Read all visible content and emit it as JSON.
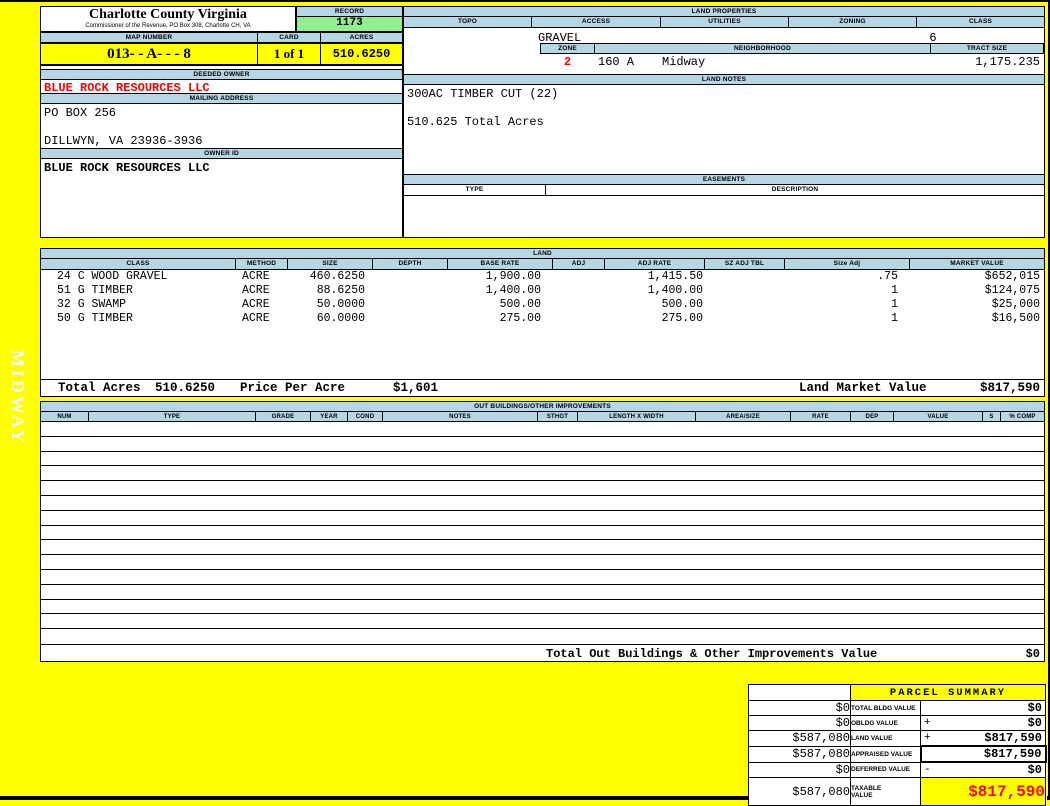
{
  "colors": {
    "header_bar": "#b5d7e5",
    "highlight_yellow": "#ffff00",
    "record_green": "#90ee90",
    "alert_red": "#ff0000"
  },
  "sidebar": {
    "district_label": "MIDWAY"
  },
  "header": {
    "county_title": "Charlotte County Virginia",
    "county_subtitle": "Commissioner of the Revenue, PO Box 308, Charlotte CH, VA",
    "record_label": "RECORD",
    "record_value": "1173",
    "map_number_label": "MAP NUMBER",
    "map_number_value": "013- - A- - - 8",
    "card_label": "CARD",
    "card_value": "1 of 1",
    "acres_label": "ACRES",
    "acres_value": "510.6250"
  },
  "owner": {
    "deeded_owner_label": "DEEDED OWNER",
    "deeded_owner_name": "BLUE ROCK RESOURCES LLC",
    "mailing_address_label": "MAILING ADDRESS",
    "mailing_address_line1": "PO BOX 256",
    "mailing_address_line2": "DILLWYN, VA 23936-3936",
    "owner_id_label": "OWNER ID",
    "owner_id_value": "BLUE ROCK RESOURCES LLC"
  },
  "land_properties": {
    "title": "LAND PROPERTIES",
    "columns": [
      "TOPO",
      "ACCESS",
      "UTILITIES",
      "ZONING",
      "CLASS"
    ],
    "access_value": "GRAVEL",
    "class_value": "6",
    "zone_label": "ZONE",
    "zone_value": "2",
    "neighborhood_label": "NEIGHBORHOOD",
    "neighborhood_code": "160 A",
    "neighborhood_name": "Midway",
    "tract_size_label": "TRACT SIZE",
    "tract_size_value": "1,175.235"
  },
  "land_notes": {
    "title": "LAND NOTES",
    "lines": [
      "300AC TIMBER CUT (22)",
      "510.625 Total Acres"
    ]
  },
  "easements": {
    "title": "EASEMENTS",
    "type_label": "TYPE",
    "description_label": "DESCRIPTION"
  },
  "land": {
    "title": "LAND",
    "columns": [
      "CLASS",
      "METHOD",
      "SIZE",
      "DEPTH",
      "BASE RATE",
      "ADJ",
      "ADJ RATE",
      "SZ ADJ TBL",
      "Size Adj",
      "MARKET VALUE"
    ],
    "rows": [
      {
        "class": "24 C WOOD GRAVEL",
        "method": "ACRE",
        "size": "460.6250",
        "depth": "",
        "base_rate": "1,900.00",
        "adj": "",
        "adj_rate": "1,415.50",
        "sz_adj_tbl": "",
        "size_adj": ".75",
        "market_value": "$652,015"
      },
      {
        "class": "51 G TIMBER",
        "method": "ACRE",
        "size": "88.6250",
        "depth": "",
        "base_rate": "1,400.00",
        "adj": "",
        "adj_rate": "1,400.00",
        "sz_adj_tbl": "",
        "size_adj": "1",
        "market_value": "$124,075"
      },
      {
        "class": "32 G SWAMP",
        "method": "ACRE",
        "size": "50.0000",
        "depth": "",
        "base_rate": "500.00",
        "adj": "",
        "adj_rate": "500.00",
        "sz_adj_tbl": "",
        "size_adj": "1",
        "market_value": "$25,000"
      },
      {
        "class": "50 G TIMBER",
        "method": "ACRE",
        "size": "60.0000",
        "depth": "",
        "base_rate": "275.00",
        "adj": "",
        "adj_rate": "275.00",
        "sz_adj_tbl": "",
        "size_adj": "1",
        "market_value": "$16,500"
      }
    ],
    "totals": {
      "total_acres_label": "Total Acres",
      "total_acres_value": "510.6250",
      "price_per_acre_label": "Price Per Acre",
      "price_per_acre_value": "$1,601",
      "land_market_value_label": "Land Market Value",
      "land_market_value": "$817,590"
    }
  },
  "out_buildings": {
    "title": "OUT BUILDINGS/OTHER IMPROVEMENTS",
    "columns": [
      "NUM",
      "TYPE",
      "GRADE",
      "YEAR",
      "COND",
      "NOTES",
      "STHGT",
      "LENGTH X WIDTH",
      "AREA/SIZE",
      "RATE",
      "DEP",
      "VALUE",
      "S",
      "% COMP"
    ],
    "empty_row_count": 15,
    "total_label": "Total Out Buildings & Other Improvements Value",
    "total_value": "$0"
  },
  "parcel_summary": {
    "title": "PARCEL SUMMARY",
    "rows": [
      {
        "left": "$0",
        "label": "TOTAL BLDG VALUE",
        "op": "",
        "value": "$0"
      },
      {
        "left": "$0",
        "label": "OBLDG VALUE",
        "op": "+",
        "value": "$0"
      },
      {
        "left": "$587,080",
        "label": "LAND VALUE",
        "op": "+",
        "value": "$817,590"
      },
      {
        "left": "$587,080",
        "label": "APPRAISED VALUE",
        "op": "",
        "value": "$817,590"
      },
      {
        "left": "$0",
        "label": "DEFERRED VALUE",
        "op": "-",
        "value": "$0"
      },
      {
        "left": "$587,080",
        "label": "TAXABLE VALUE",
        "op": "",
        "value": "$817,590"
      }
    ]
  }
}
